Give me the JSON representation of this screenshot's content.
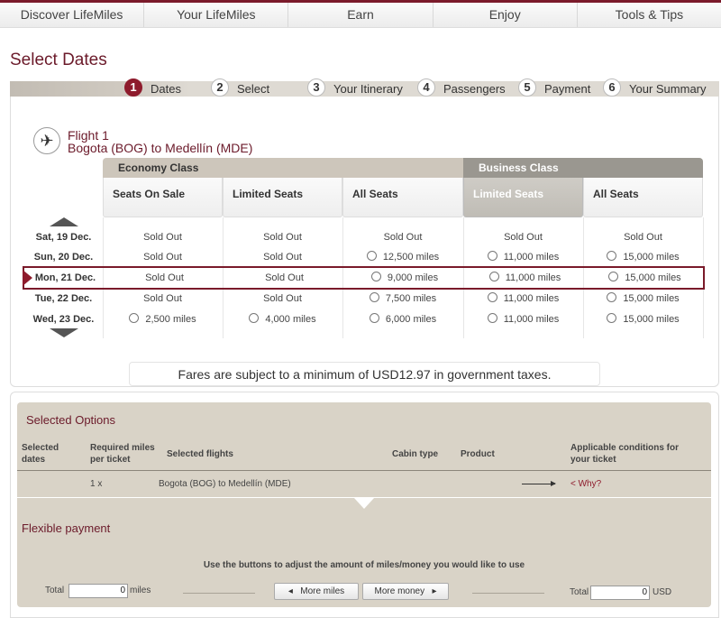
{
  "nav": [
    "Discover LifeMiles",
    "Your LifeMiles",
    "Earn",
    "Enjoy",
    "Tools & Tips"
  ],
  "page_title": "Select Dates",
  "steps": [
    {
      "num": "1",
      "label": "Dates",
      "active": true
    },
    {
      "num": "2",
      "label": "Select"
    },
    {
      "num": "3",
      "label": "Your Itinerary"
    },
    {
      "num": "4",
      "label": "Passengers"
    },
    {
      "num": "5",
      "label": "Payment"
    },
    {
      "num": "6",
      "label": "Your Summary"
    }
  ],
  "flight": {
    "label": "Flight 1",
    "route": "Bogota (BOG) to Medellín (MDE)",
    "plane_icon": "airplane-icon"
  },
  "cabins": {
    "economy": "Economy Class",
    "business": "Business Class"
  },
  "columns": [
    "Seats On Sale",
    "Limited Seats",
    "All Seats",
    "Limited Seats",
    "All Seats"
  ],
  "rows": [
    {
      "date": "Sat, 19 Dec.",
      "cells": [
        {
          "t": "Sold Out"
        },
        {
          "t": "Sold Out"
        },
        {
          "t": "Sold Out"
        },
        {
          "t": "Sold Out"
        },
        {
          "t": "Sold Out"
        }
      ]
    },
    {
      "date": "Sun, 20 Dec.",
      "cells": [
        {
          "t": "Sold Out"
        },
        {
          "t": "Sold Out"
        },
        {
          "t": "12,500 miles",
          "r": 1
        },
        {
          "t": "11,000 miles",
          "r": 1
        },
        {
          "t": "15,000 miles",
          "r": 1
        }
      ]
    },
    {
      "date": "Mon, 21 Dec.",
      "selected": true,
      "cells": [
        {
          "t": "Sold Out"
        },
        {
          "t": "Sold Out"
        },
        {
          "t": "9,000 miles",
          "r": 1
        },
        {
          "t": "11,000 miles",
          "r": 1
        },
        {
          "t": "15,000 miles",
          "r": 1
        }
      ]
    },
    {
      "date": "Tue, 22 Dec.",
      "cells": [
        {
          "t": "Sold Out"
        },
        {
          "t": "Sold Out"
        },
        {
          "t": "7,500 miles",
          "r": 1
        },
        {
          "t": "11,000 miles",
          "r": 1
        },
        {
          "t": "15,000 miles",
          "r": 1
        }
      ]
    },
    {
      "date": "Wed, 23 Dec.",
      "cells": [
        {
          "t": "2,500 miles",
          "r": 1
        },
        {
          "t": "4,000 miles",
          "r": 1
        },
        {
          "t": "6,000 miles",
          "r": 1
        },
        {
          "t": "11,000 miles",
          "r": 1
        },
        {
          "t": "15,000 miles",
          "r": 1
        }
      ]
    }
  ],
  "taxes_note": "Fares are subject to a minimum of USD12.97 in government taxes.",
  "selected_options": {
    "title": "Selected Options",
    "headers": {
      "dates": "Selected dates",
      "miles": "Required miles per ticket",
      "flights": "Selected flights",
      "cabin": "Cabin type",
      "product": "Product",
      "conditions": "Applicable conditions for your ticket"
    },
    "row": {
      "miles": "1 x",
      "flight": "Bogota (BOG) to Medellín (MDE)",
      "why": "< Why?"
    }
  },
  "flexible": {
    "title": "Flexible payment",
    "hint": "Use the buttons to adjust the amount of miles/money you would like to use",
    "total_label": "Total",
    "miles_value": "0",
    "miles_unit": "miles",
    "more_miles": "More miles",
    "more_money": "More money",
    "usd_value": "0",
    "usd_unit": "USD"
  },
  "colors": {
    "brand": "#8e1b2c",
    "panel": "#d9d3c7"
  }
}
